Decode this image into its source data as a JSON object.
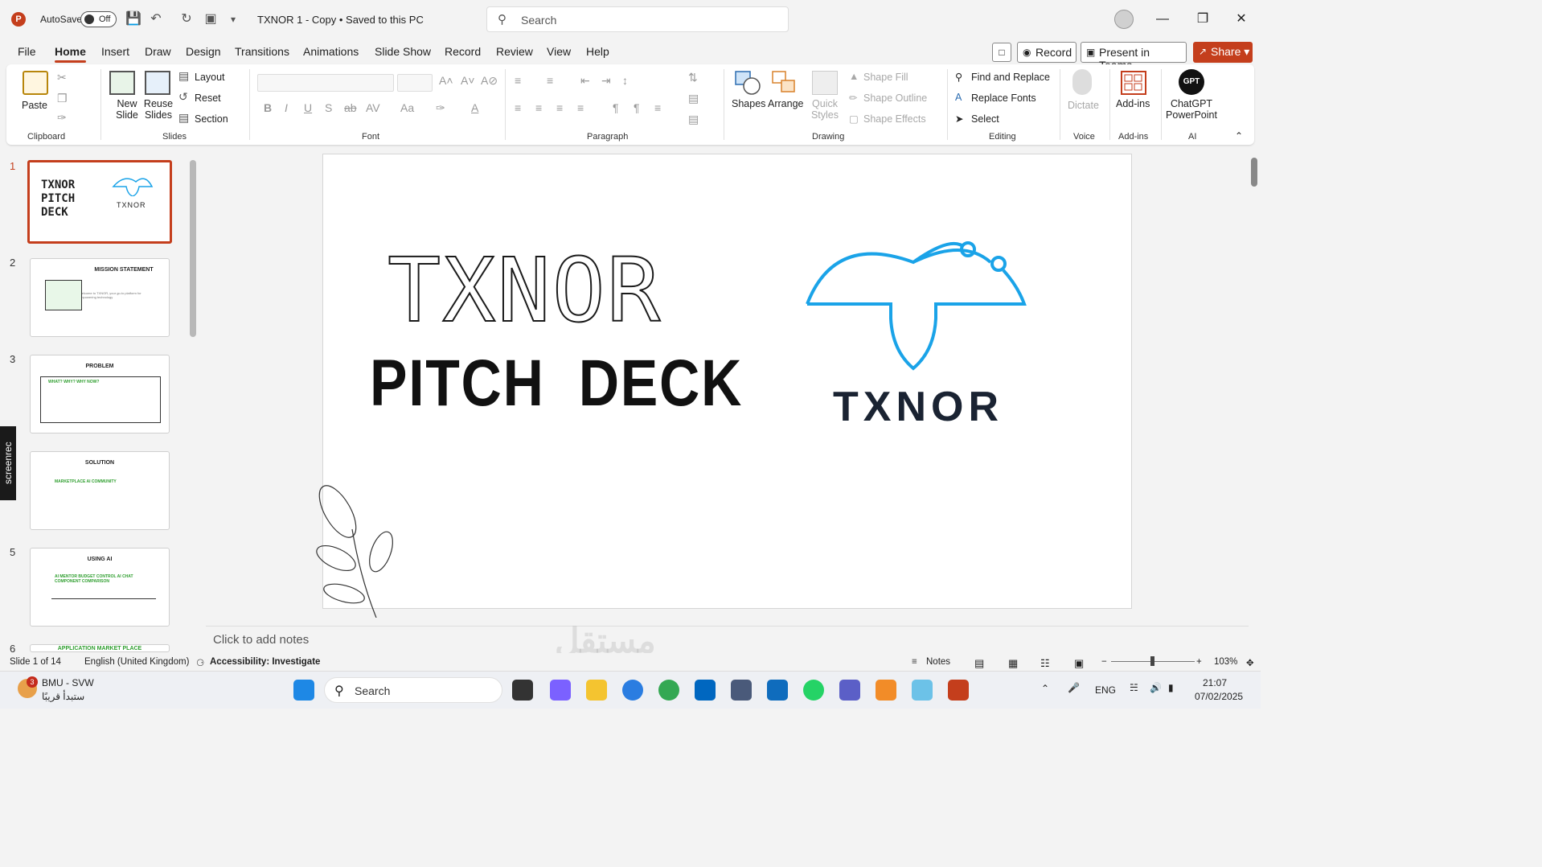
{
  "titlebar": {
    "autosave_label": "AutoSave",
    "autosave_state": "Off",
    "doc_title": "TXNOR 1 - Copy • Saved to this PC",
    "search_placeholder": "Search"
  },
  "menu": {
    "tabs": [
      "File",
      "Home",
      "Insert",
      "Draw",
      "Design",
      "Transitions",
      "Animations",
      "Slide Show",
      "Record",
      "Review",
      "View",
      "Help"
    ],
    "active_tab": "Home",
    "record_label": "Record",
    "present_label": "Present in Teams",
    "share_label": "Share"
  },
  "ribbon": {
    "clipboard": {
      "label": "Clipboard",
      "paste": "Paste"
    },
    "slides": {
      "label": "Slides",
      "new_slide": "New Slide",
      "reuse_slides": "Reuse Slides",
      "layout": "Layout",
      "reset": "Reset",
      "section": "Section"
    },
    "font": {
      "label": "Font"
    },
    "paragraph": {
      "label": "Paragraph"
    },
    "drawing": {
      "label": "Drawing",
      "shapes": "Shapes",
      "arrange": "Arrange",
      "quick_styles": "Quick Styles",
      "shape_fill": "Shape Fill",
      "shape_outline": "Shape Outline",
      "shape_effects": "Shape Effects"
    },
    "editing": {
      "label": "Editing",
      "find_replace": "Find and Replace",
      "replace_fonts": "Replace Fonts",
      "select": "Select"
    },
    "voice": {
      "label": "Voice",
      "dictate": "Dictate"
    },
    "addins": {
      "label": "Add-ins",
      "addins": "Add-ins"
    },
    "ai": {
      "label": "AI",
      "chatgpt": "ChatGPT PowerPoint",
      "gpt_badge": "GPT"
    }
  },
  "thumbnails": [
    {
      "num": "1",
      "title": "TXNOR PITCH DECK",
      "selected": true
    },
    {
      "num": "2",
      "title": "MISSION STATEMENT",
      "text": "Welcome to TXNOR, your go-to platform for empowering technology"
    },
    {
      "num": "3",
      "title": "PROBLEM",
      "text": "WHAT? WHY? WHY NOW?"
    },
    {
      "num": "4",
      "title": "SOLUTION",
      "text": "MARKETPLACE  AI  COMMUNITY"
    },
    {
      "num": "5",
      "title": "USING AI",
      "text": "AI MENTOR  BUDGET CONTROL  AI CHAT  COMPONENT COMPARISON"
    },
    {
      "num": "6",
      "title": "APPLICATION MARKET PLACE"
    }
  ],
  "slide": {
    "outline_word": "TXNOR",
    "solid_word": "PITCH  DECK",
    "logo_text": "TXNOR"
  },
  "notes_placeholder": "Click to add notes",
  "status": {
    "slide_counter": "Slide 1 of 14",
    "language": "English (United Kingdom)",
    "accessibility": "Accessibility: Investigate",
    "notes": "Notes",
    "zoom": "103%"
  },
  "taskbar": {
    "user_line1": "BMU - SVW",
    "user_line2": "ستبدأ قريبًا",
    "badge": "3",
    "search": "Search",
    "lang": "ENG",
    "time": "21:07",
    "date": "07/02/2025"
  },
  "screenrec_label": "screenrec",
  "watermark": "مستقل",
  "colors": {
    "accent": "#c43e1c",
    "logo_blue": "#1aa3e8"
  }
}
